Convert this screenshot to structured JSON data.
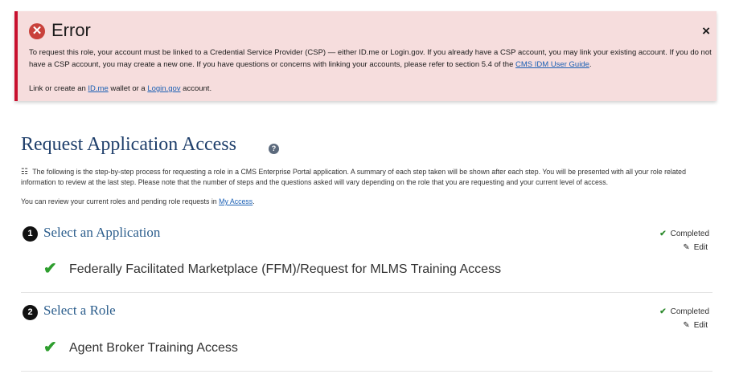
{
  "alert": {
    "title": "Error",
    "close": "×",
    "body_prefix": "To request this role, your account must be linked to a Credential Service Provider (CSP) — either ID.me or Login.gov. If you already have a CSP account, you may link your existing account. If you do not have a CSP account, you may create a new one. If you have questions or concerns with linking your accounts, please refer to section 5.4 of the ",
    "guide_link": "CMS IDM User Guide",
    "body_suffix": ".",
    "link_line_prefix": "Link or create an ",
    "idme_link": "ID.me",
    "link_line_middle": " wallet or a ",
    "logingov_link": "Login.gov",
    "link_line_suffix": " account."
  },
  "page": {
    "title": "Request Application Access",
    "help": "?",
    "intro": "The following is the step-by-step process for requesting a role in a CMS Enterprise Portal application. A summary of each step taken will be shown after each step. You will be presented with all your role related information to review at the last step. Please note that the number of steps and the questions asked will vary depending on the role that you are requesting and your current level of access.",
    "access_prefix": "You can review your current roles and pending role requests in ",
    "access_link": "My Access",
    "access_suffix": "."
  },
  "steps": [
    {
      "number": "1",
      "title": "Select an Application",
      "status": "Completed",
      "edit": "Edit",
      "selection": "Federally Facilitated Marketplace (FFM)/Request for MLMS Training Access"
    },
    {
      "number": "2",
      "title": "Select a Role",
      "status": "Completed",
      "edit": "Edit",
      "selection": "Agent Broker Training Access"
    }
  ],
  "icons": {
    "error": "error-circle-icon",
    "close": "close-icon",
    "help": "help-icon",
    "list": "list-icon",
    "check": "check-icon",
    "edit": "pencil-icon"
  },
  "colors": {
    "error_border": "#c8102e",
    "error_bg": "#f6dddd",
    "title": "#1f3f6b",
    "step_title": "#2b5d8c",
    "check": "#2e9e2e",
    "link": "#1a5fb4"
  }
}
